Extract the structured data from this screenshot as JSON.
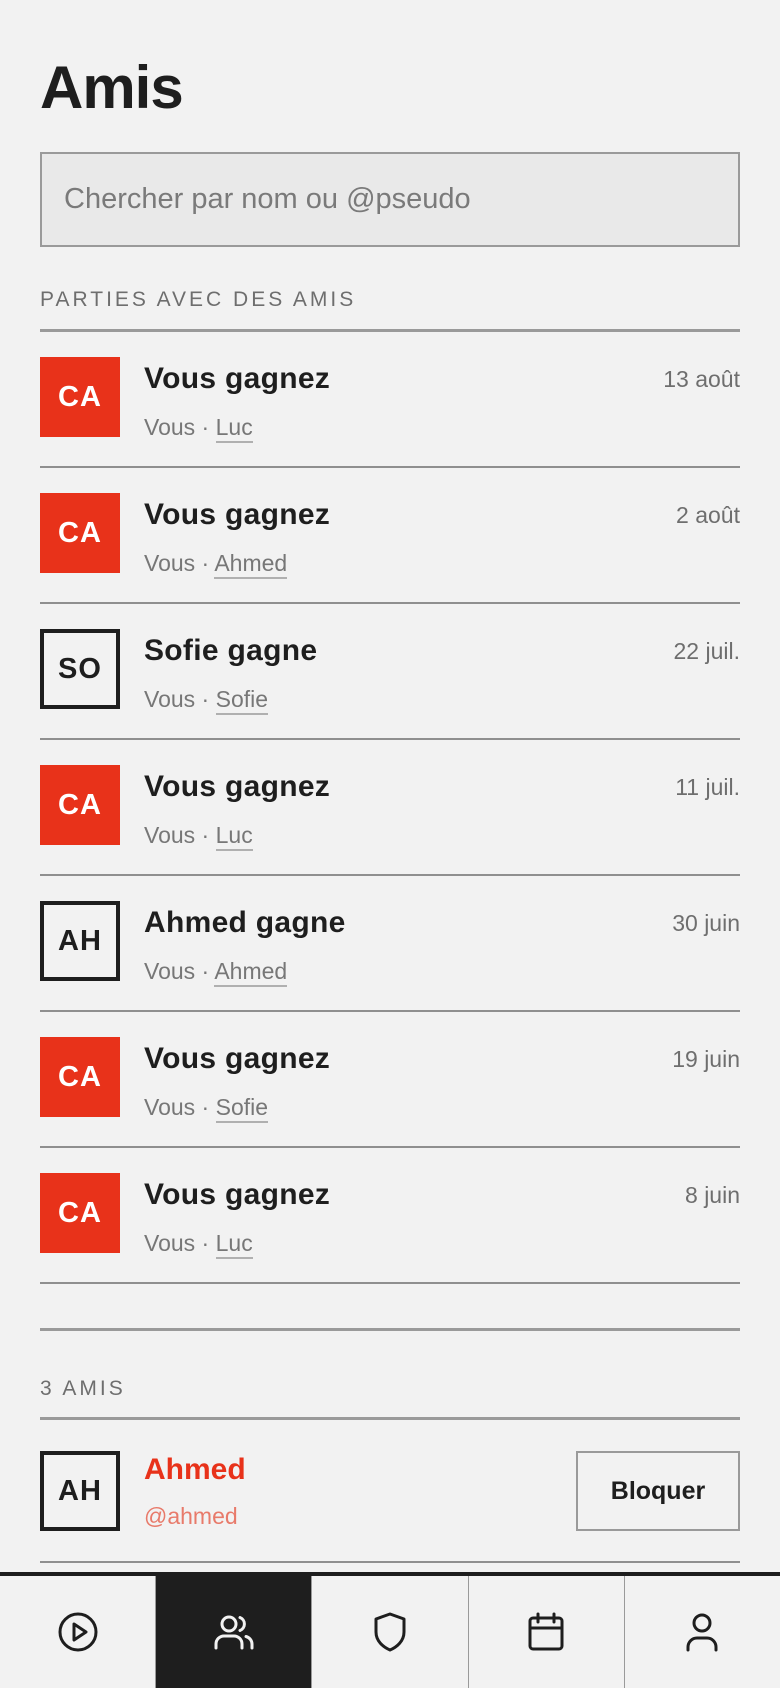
{
  "header": {
    "title": "Amis"
  },
  "search": {
    "placeholder": "Chercher par nom ou @pseudo"
  },
  "games_section": {
    "label": "PARTIES AVEC DES AMIS",
    "games": [
      {
        "avatar": "CA",
        "avatar_style": "filled",
        "result": "Vous gagnez",
        "you": "Vous",
        "sep": "·",
        "opponent": "Luc",
        "date": "13 août"
      },
      {
        "avatar": "CA",
        "avatar_style": "filled",
        "result": "Vous gagnez",
        "you": "Vous",
        "sep": "·",
        "opponent": "Ahmed",
        "date": "2 août"
      },
      {
        "avatar": "SO",
        "avatar_style": "outline",
        "result": "Sofie gagne",
        "you": "Vous",
        "sep": "·",
        "opponent": "Sofie",
        "date": "22 juil."
      },
      {
        "avatar": "CA",
        "avatar_style": "filled",
        "result": "Vous gagnez",
        "you": "Vous",
        "sep": "·",
        "opponent": "Luc",
        "date": "11 juil."
      },
      {
        "avatar": "AH",
        "avatar_style": "outline",
        "result": "Ahmed gagne",
        "you": "Vous",
        "sep": "·",
        "opponent": "Ahmed",
        "date": "30 juin"
      },
      {
        "avatar": "CA",
        "avatar_style": "filled",
        "result": "Vous gagnez",
        "you": "Vous",
        "sep": "·",
        "opponent": "Sofie",
        "date": "19 juin"
      },
      {
        "avatar": "CA",
        "avatar_style": "filled",
        "result": "Vous gagnez",
        "you": "Vous",
        "sep": "·",
        "opponent": "Luc",
        "date": "8 juin"
      }
    ]
  },
  "friends_section": {
    "label": "3 AMIS",
    "friends": [
      {
        "avatar": "AH",
        "name": "Ahmed",
        "handle": "@ahmed",
        "action": "Bloquer"
      }
    ]
  },
  "tabbar": {
    "tabs": [
      {
        "icon": "play-icon",
        "active": false
      },
      {
        "icon": "users-icon",
        "active": true
      },
      {
        "icon": "shield-icon",
        "active": false
      },
      {
        "icon": "calendar-icon",
        "active": false
      },
      {
        "icon": "user-icon",
        "active": false
      }
    ]
  },
  "colors": {
    "accent": "#e8321a",
    "dark": "#1e1e1e",
    "background": "#f2f2f2",
    "muted": "#777777"
  }
}
